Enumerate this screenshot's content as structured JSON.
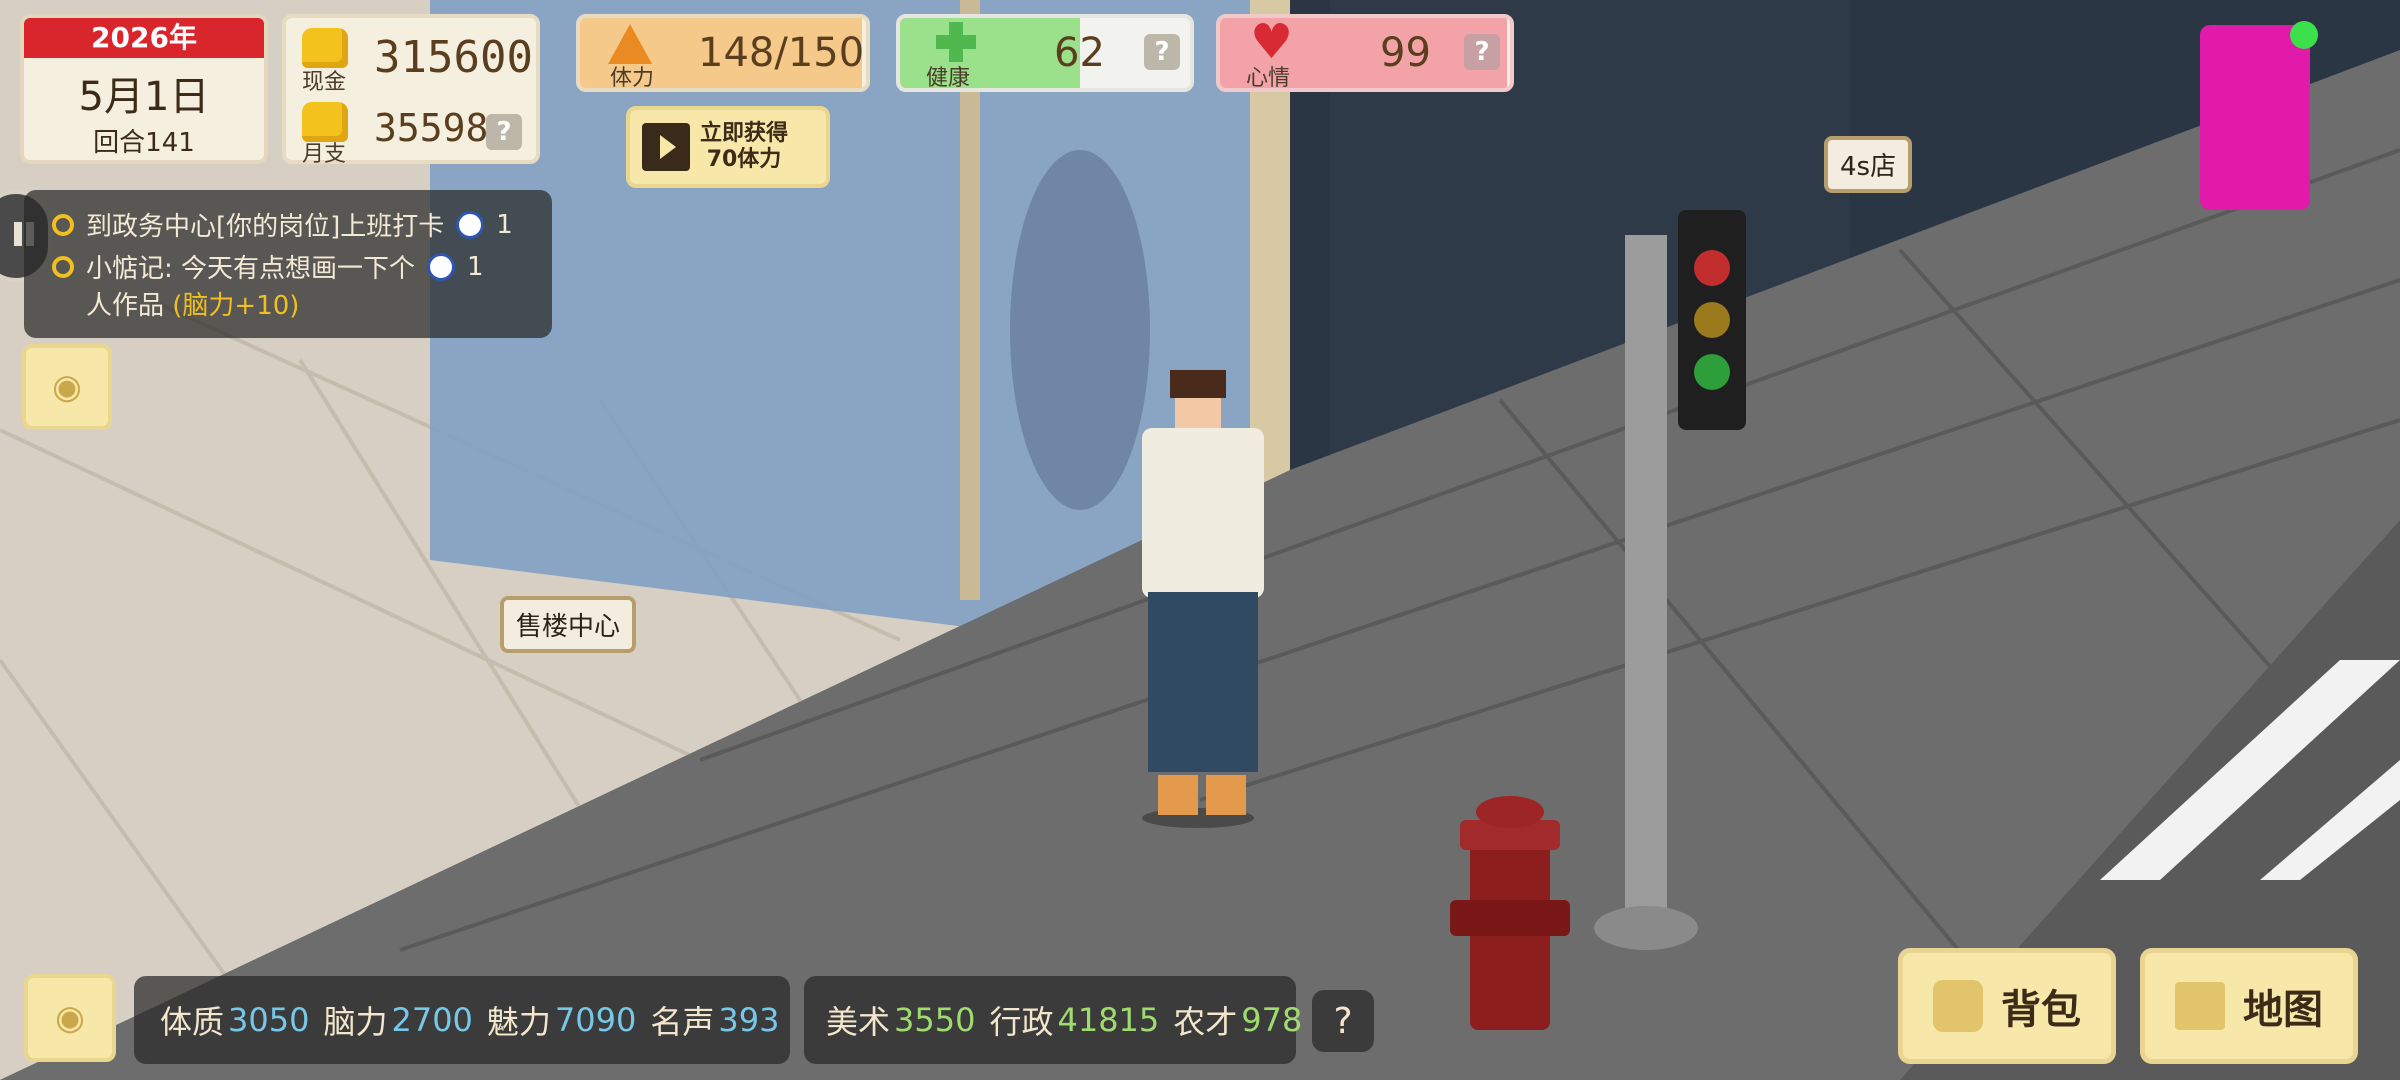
{
  "date": {
    "year": "2026年",
    "day": "5月1日",
    "round": "回合141"
  },
  "money": {
    "cash_label": "现金",
    "cash_value": "315600",
    "monthly_label": "月支",
    "monthly_value": "35598",
    "help": "?"
  },
  "stamina": {
    "label": "体力",
    "value": "148/150",
    "ad_button_line1": "立即获得",
    "ad_button_line2": "70体力",
    "level": 0.987
  },
  "health": {
    "label": "健康",
    "value": "62",
    "help": "?",
    "level": 0.62
  },
  "mood": {
    "label": "心情",
    "value": "99",
    "help": "?",
    "level": 0.99
  },
  "tasks": [
    {
      "text": "到政务中心[你的岗位]上班打卡",
      "suffix": "1"
    },
    {
      "text": "小惦记: 今天有点想画一下个",
      "text2": "人作品",
      "reward": "(脑力+10)",
      "suffix": "1"
    }
  ],
  "places": {
    "sales_center": "售楼中心",
    "car_dealer": "4s店"
  },
  "stats": [
    {
      "name": "体质",
      "value": "3050"
    },
    {
      "name": "脑力",
      "value": "2700"
    },
    {
      "name": "魅力",
      "value": "7090"
    },
    {
      "name": "名声",
      "value": "393"
    }
  ],
  "skills": [
    {
      "name": "美术",
      "value": "3550"
    },
    {
      "name": "行政",
      "value": "41815"
    },
    {
      "name": "农才",
      "value": "978"
    }
  ],
  "skills_help": "?",
  "buttons": {
    "backpack": "背包",
    "map": "地图"
  },
  "colors": {
    "stamina": "#f5c98a",
    "health": "#9be08a",
    "mood": "#f3a3a8",
    "date_header": "#d9262c"
  }
}
